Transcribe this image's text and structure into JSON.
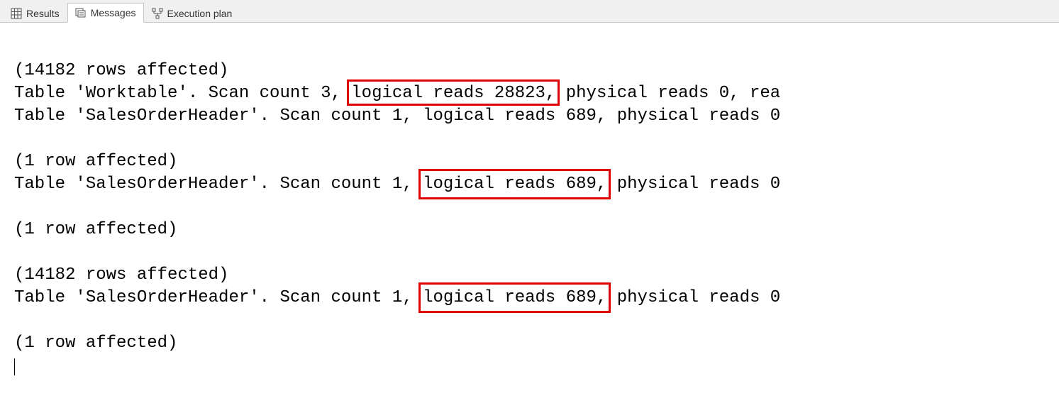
{
  "tabs": {
    "results": "Results",
    "messages": "Messages",
    "execution_plan": "Execution plan"
  },
  "highlight_color": "#e00000",
  "messages": {
    "block1": {
      "rows_affected": "(14182 rows affected)",
      "line1_pre": "Table 'Worktable'. Scan count 3, ",
      "line1_hl": "logical reads 28823,",
      "line1_post": " physical reads 0, rea",
      "line2": "Table 'SalesOrderHeader'. Scan count 1, logical reads 689, physical reads 0"
    },
    "block2": {
      "rows_affected": "(1 row affected)",
      "line1_pre": "Table 'SalesOrderHeader'. Scan count 1, ",
      "line1_hl": "logical reads 689,",
      "line1_post": " physical reads 0"
    },
    "block3": {
      "rows_affected": "(1 row affected)"
    },
    "block4": {
      "rows_affected": "(14182 rows affected)",
      "line1_pre": "Table 'SalesOrderHeader'. Scan count 1, ",
      "line1_hl": "logical reads 689,",
      "line1_post": " physical reads 0"
    },
    "block5": {
      "rows_affected": "(1 row affected)"
    }
  }
}
